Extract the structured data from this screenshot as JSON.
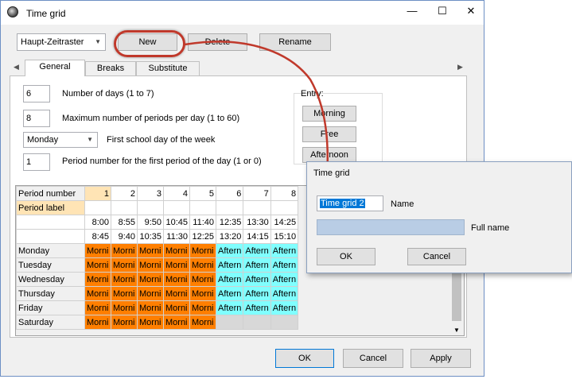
{
  "window": {
    "title": "Time grid",
    "minimize": "—",
    "maximize": "☐",
    "close": "✕"
  },
  "toolbar": {
    "grid_select": "Haupt-Zeitraster",
    "new_label": "New",
    "delete_label": "Delete",
    "rename_label": "Rename"
  },
  "tabs": [
    {
      "label": "General"
    },
    {
      "label": "Breaks"
    },
    {
      "label": "Substitute"
    }
  ],
  "settings": {
    "num_days_value": "6",
    "num_days_label": "Number of days (1 to 7)",
    "max_periods_value": "8",
    "max_periods_label": "Maximum number of periods per day (1 to 60)",
    "first_day_value": "Monday",
    "first_day_label": "First school day of the week",
    "first_period_value": "1",
    "first_period_label": "Period number for the first period of the day (1 or 0)"
  },
  "entry": {
    "title": "Entry:",
    "morning": "Morning",
    "free": "Free",
    "afternoon": "Afternoon"
  },
  "grid": {
    "period_number_label": "Period number",
    "period_label_label": "Period label",
    "periods": [
      "1",
      "2",
      "3",
      "4",
      "5",
      "6",
      "7",
      "8"
    ],
    "start_times": [
      "8:00",
      "8:55",
      "9:50",
      "10:45",
      "11:40",
      "12:35",
      "13:30",
      "14:25"
    ],
    "end_times": [
      "8:45",
      "9:40",
      "10:35",
      "11:30",
      "12:25",
      "13:20",
      "14:15",
      "15:10"
    ],
    "days": [
      {
        "name": "Monday",
        "cells": [
          "Morni",
          "Morni",
          "Morni",
          "Morni",
          "Morni",
          "Aftern",
          "Aftern",
          "Aftern"
        ]
      },
      {
        "name": "Tuesday",
        "cells": [
          "Morni",
          "Morni",
          "Morni",
          "Morni",
          "Morni",
          "Aftern",
          "Aftern",
          "Aftern"
        ]
      },
      {
        "name": "Wednesday",
        "cells": [
          "Morni",
          "Morni",
          "Morni",
          "Morni",
          "Morni",
          "Aftern",
          "Aftern",
          "Aftern"
        ]
      },
      {
        "name": "Thursday",
        "cells": [
          "Morni",
          "Morni",
          "Morni",
          "Morni",
          "Morni",
          "Aftern",
          "Aftern",
          "Aftern"
        ]
      },
      {
        "name": "Friday",
        "cells": [
          "Morni",
          "Morni",
          "Morni",
          "Morni",
          "Morni",
          "Aftern",
          "Aftern",
          "Aftern"
        ]
      },
      {
        "name": "Saturday",
        "cells": [
          "Morni",
          "Morni",
          "Morni",
          "Morni",
          "Morni",
          "",
          "",
          ""
        ]
      }
    ]
  },
  "footer": {
    "ok_label": "OK",
    "cancel_label": "Cancel",
    "apply_label": "Apply"
  },
  "dialog": {
    "title": "Time grid",
    "name_value": "Time grid 2",
    "name_label": "Name",
    "fullname_value": "",
    "fullname_label": "Full name",
    "ok_label": "OK",
    "cancel_label": "Cancel"
  },
  "colors": {
    "morning": "#ff7f00",
    "afternoon": "#80ffff",
    "annotation": "#c0392b"
  }
}
